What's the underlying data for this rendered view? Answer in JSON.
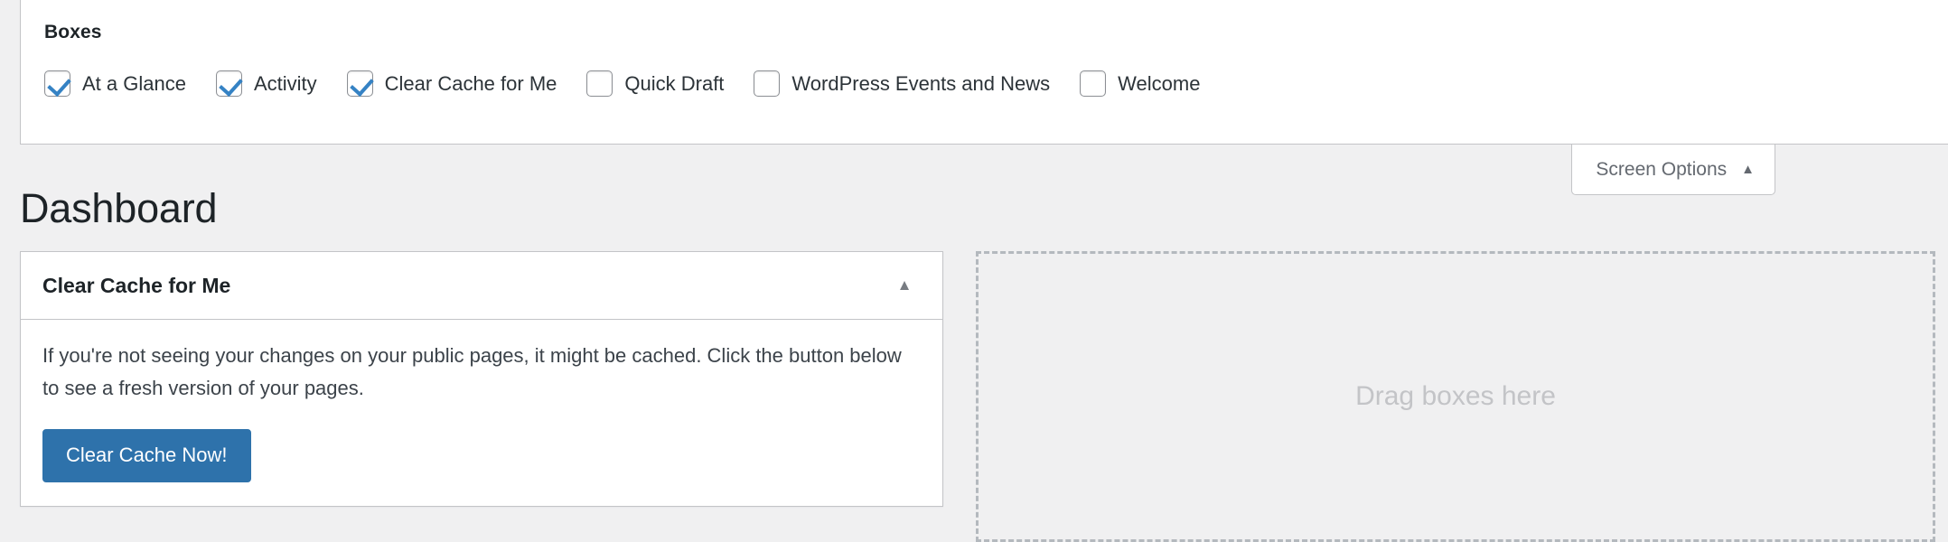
{
  "screen_options": {
    "section_title": "Boxes",
    "boxes": [
      {
        "label": "At a Glance",
        "checked": true
      },
      {
        "label": "Activity",
        "checked": true
      },
      {
        "label": "Clear Cache for Me",
        "checked": true
      },
      {
        "label": "Quick Draft",
        "checked": false
      },
      {
        "label": "WordPress Events and News",
        "checked": false
      },
      {
        "label": "Welcome",
        "checked": false
      }
    ],
    "tab_label": "Screen Options",
    "tab_caret": "▲"
  },
  "page": {
    "title": "Dashboard"
  },
  "widgets": {
    "clear_cache": {
      "title": "Clear Cache for Me",
      "toggle_caret": "▲",
      "body_text": "If you're not seeing your changes on your public pages, it might be cached. Click the button below to see a fresh version of your pages.",
      "button_label": "Clear Cache Now!"
    }
  },
  "dropzone": {
    "label": "Drag boxes here"
  },
  "colors": {
    "accent_blue": "#2e72ab",
    "checkbox_check": "#3582c4",
    "page_background": "#f0f0f1",
    "panel_background": "#ffffff",
    "border_gray": "#c3c4c7",
    "dropzone_border": "#b4b9be",
    "dropzone_text": "#c3c4c7"
  }
}
